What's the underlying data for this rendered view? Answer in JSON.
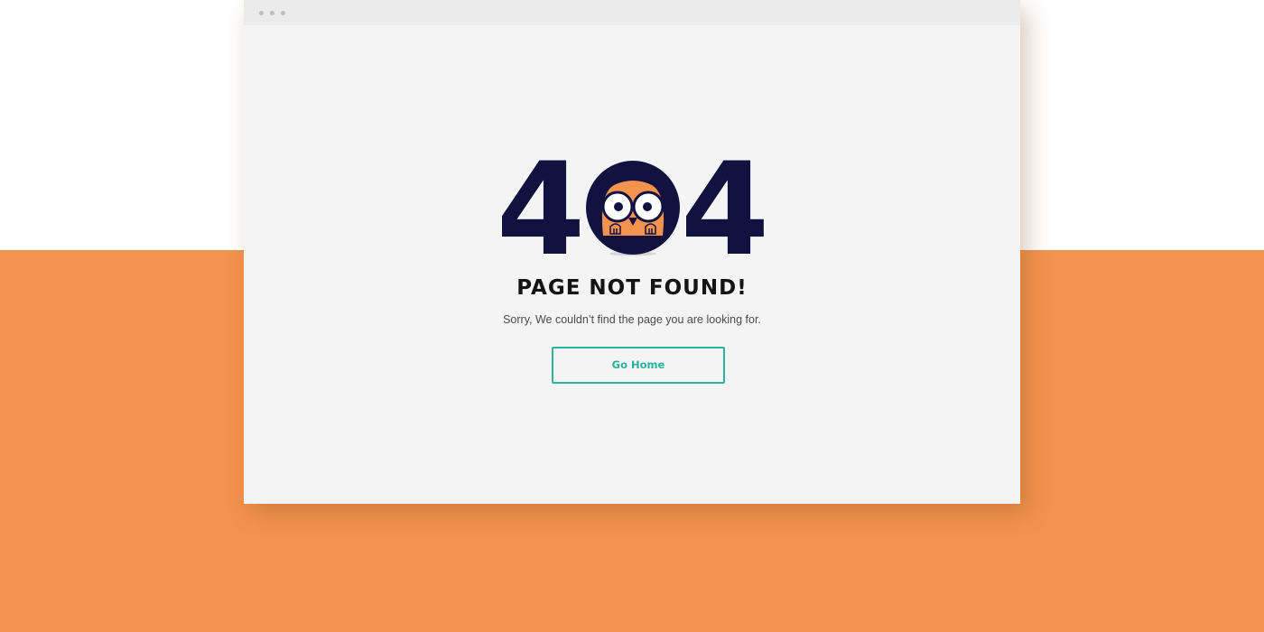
{
  "page": {
    "title": "PAGE NOT FOUND!",
    "message": "Sorry, We couldn’t find the page you are looking for.",
    "button_label": "Go Home"
  },
  "graphic": {
    "left_digit": "4",
    "right_digit": "4",
    "middle": "owl-face-icon"
  },
  "colors": {
    "background_band": "#f4934e",
    "window": "#f4f4f4",
    "digits": "#111240",
    "owl_face": "#f4934e",
    "button_accent": "#2db39e"
  }
}
